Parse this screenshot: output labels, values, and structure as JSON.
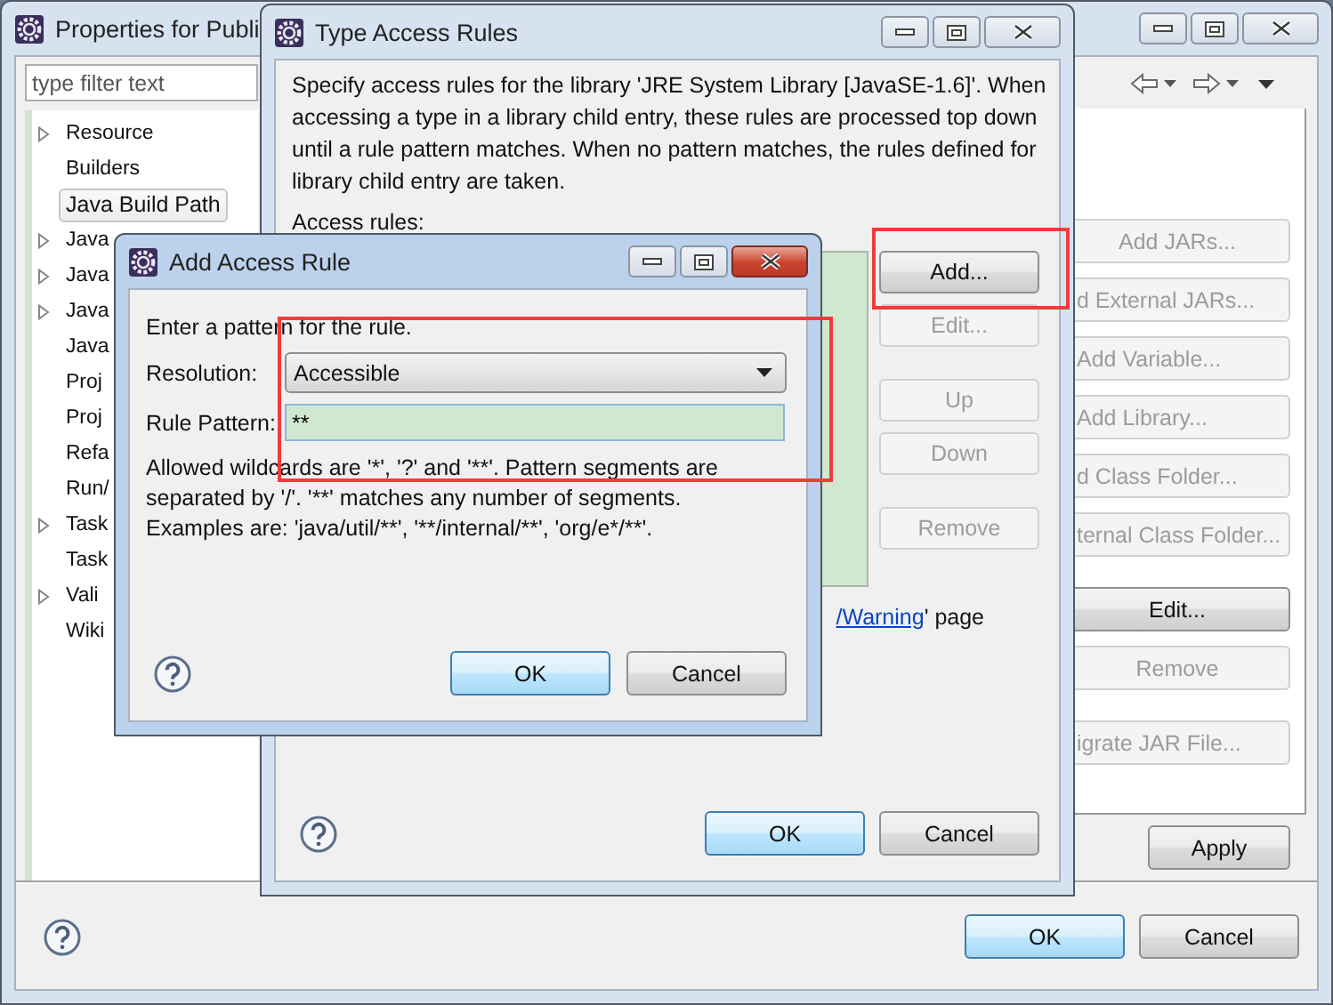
{
  "properties_window": {
    "title": "Properties for Publi",
    "active": false,
    "filter": {
      "placeholder": "type filter text"
    },
    "tree": [
      {
        "label": "Resource",
        "expandable": true,
        "selected": false
      },
      {
        "label": "Builders",
        "expandable": false,
        "selected": false
      },
      {
        "label": "Java Build Path",
        "expandable": false,
        "selected": true
      },
      {
        "label": "Java",
        "expandable": true,
        "selected": false
      },
      {
        "label": "Java",
        "expandable": true,
        "selected": false
      },
      {
        "label": "Java",
        "expandable": true,
        "selected": false
      },
      {
        "label": "Java",
        "expandable": false,
        "selected": false
      },
      {
        "label": "Proj",
        "expandable": false,
        "selected": false
      },
      {
        "label": "Proj",
        "expandable": false,
        "selected": false
      },
      {
        "label": "Refa",
        "expandable": false,
        "selected": false
      },
      {
        "label": "Run/",
        "expandable": false,
        "selected": false
      },
      {
        "label": "Task",
        "expandable": true,
        "selected": false
      },
      {
        "label": "Task",
        "expandable": false,
        "selected": false
      },
      {
        "label": "Vali",
        "expandable": true,
        "selected": false
      },
      {
        "label": "Wiki",
        "expandable": false,
        "selected": false
      }
    ],
    "side_buttons": [
      {
        "label": "Add JARs...",
        "disabled": true
      },
      {
        "label": "d External JARs...",
        "disabled": true
      },
      {
        "label": "Add Variable...",
        "disabled": true
      },
      {
        "label": "Add Library...",
        "disabled": true
      },
      {
        "label": "d Class Folder...",
        "disabled": true
      },
      {
        "label": "ternal Class Folder...",
        "disabled": true
      },
      {
        "label": "Edit...",
        "disabled": false
      },
      {
        "label": "Remove",
        "disabled": true
      },
      {
        "label": "igrate JAR File...",
        "disabled": true
      }
    ],
    "apply_button": {
      "label": "Apply"
    },
    "buttons": [
      {
        "label": "OK",
        "default": true
      },
      {
        "label": "Cancel",
        "default": false
      }
    ]
  },
  "type_access_rules_dialog": {
    "title": "Type Access Rules",
    "active": false,
    "description": "Specify access rules for the library 'JRE System Library [JavaSE-1.6]'. When accessing a type in a library child entry, these rules are processed top down until a rule pattern matches. When no pattern matches, the rules defined for library child entry are taken.",
    "list_label": "Access rules:",
    "rule_buttons": [
      {
        "label": "Add...",
        "disabled": false
      },
      {
        "label": "Edit...",
        "disabled": true
      },
      {
        "label": "Up",
        "disabled": true
      },
      {
        "label": "Down",
        "disabled": true
      },
      {
        "label": "Remove",
        "disabled": true
      }
    ],
    "note": {
      "link": "/Warning",
      "text": "' page"
    },
    "buttons": [
      {
        "label": "OK",
        "default": true
      },
      {
        "label": "Cancel",
        "default": false
      }
    ]
  },
  "add_access_rule_dialog": {
    "title": "Add Access Rule",
    "active": true,
    "instruction": "Enter a pattern for the rule.",
    "resolution": {
      "label": "Resolution:",
      "value": "Accessible"
    },
    "rule_pattern": {
      "label": "Rule Pattern:",
      "value": "**"
    },
    "hint": "Allowed wildcards are '*', '?' and '**'. Pattern segments are separated by '/'. '**' matches any number of segments. Examples are: 'java/util/**', '**/internal/**', 'org/e*/**'.",
    "buttons": [
      {
        "label": "OK",
        "default": true
      },
      {
        "label": "Cancel",
        "default": false
      }
    ]
  },
  "annotations": [
    {
      "kind": "rectangle"
    },
    {
      "kind": "rectangle"
    }
  ]
}
